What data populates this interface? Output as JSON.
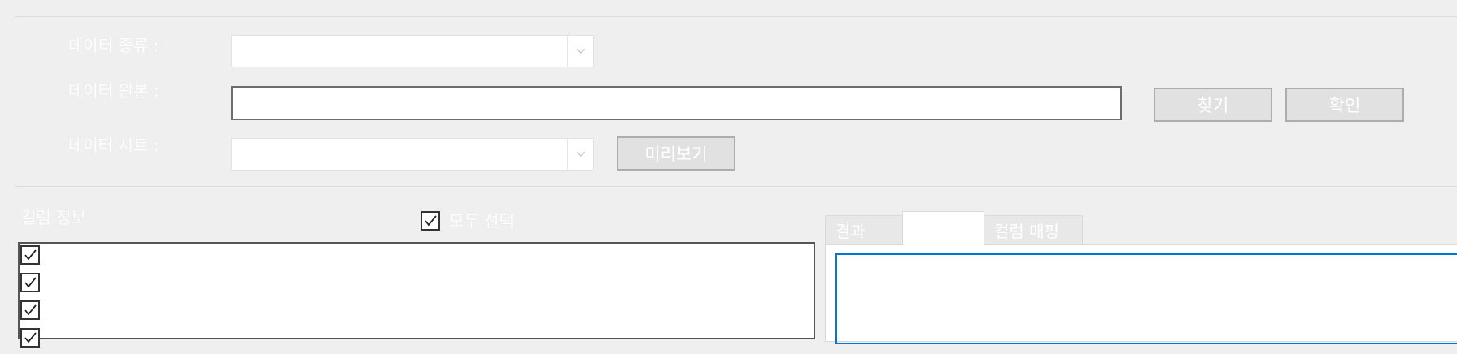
{
  "form": {
    "data_type_label": "데이터 종류 :",
    "data_source_label": "데이터 원본 :",
    "data_sheet_label": "데이터 시트 :",
    "data_type_value": "",
    "data_source_value": "",
    "data_sheet_value": "",
    "find_button": "찾기",
    "confirm_button": "확인",
    "preview_button": "미리보기"
  },
  "columns": {
    "title": "컬럼 정보",
    "select_all_label": "모두 선택",
    "select_all_checked": true,
    "items": [
      {
        "label": "",
        "checked": true
      },
      {
        "label": "",
        "checked": true
      },
      {
        "label": "",
        "checked": true
      },
      {
        "label": "",
        "checked": true
      }
    ]
  },
  "tabs": [
    {
      "label": "결과",
      "active": false
    },
    {
      "label": "",
      "active": true
    },
    {
      "label": "컬럼 매핑",
      "active": false
    }
  ],
  "colors": {
    "background": "#efefef",
    "focus_border": "#0078d7",
    "label_text": "#ffffff"
  }
}
